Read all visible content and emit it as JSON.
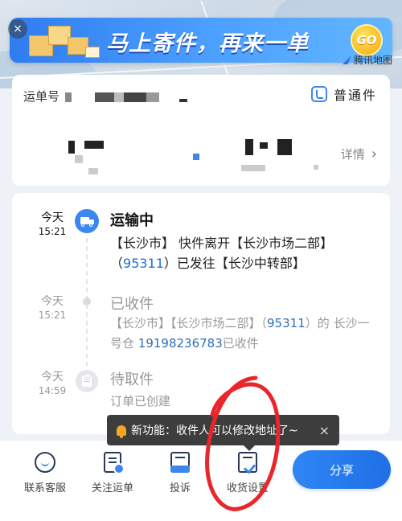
{
  "banner": {
    "close": "×",
    "headline": "马上寄件，再来一单",
    "go": "GO"
  },
  "map": {
    "attribution": "腾讯地图"
  },
  "waybill": {
    "label": "运单号",
    "service_label": "普通件",
    "detail_label": "详情",
    "detail_chevron": "›"
  },
  "timeline": [
    {
      "day": "今天",
      "time": "15:21",
      "status": "运输中",
      "text_parts": [
        "【长沙市】 快件离开【长沙市场二部】（",
        "95311",
        "）已发往【长沙中转部】"
      ],
      "state": "active",
      "icon": "truck-icon"
    },
    {
      "day": "今天",
      "time": "15:21",
      "status": "已收件",
      "text_parts": [
        "【长沙市】【长沙市场二部】（",
        "95311",
        "）的 长沙一号仓 ",
        "19198236783",
        "已收件"
      ],
      "state": "done",
      "icon": "dot-icon"
    },
    {
      "day": "今天",
      "time": "14:59",
      "status": "待取件",
      "text_parts": [
        "订单已创建"
      ],
      "state": "done",
      "icon": "clipboard-icon"
    }
  ],
  "tooltip": {
    "text": "新功能：收件人可以修改地址了~",
    "close": "×"
  },
  "bottom_nav": [
    {
      "label": "联系客服",
      "icon": "chat-icon"
    },
    {
      "label": "关注运单",
      "icon": "follow-icon"
    },
    {
      "label": "投诉",
      "icon": "complaint-icon"
    },
    {
      "label": "收货设置",
      "icon": "package-settings-icon"
    }
  ],
  "share_button": "分享",
  "colors": {
    "accent": "#3b86f0",
    "link": "#1e6fd9",
    "annotation_red": "#e8262b"
  }
}
